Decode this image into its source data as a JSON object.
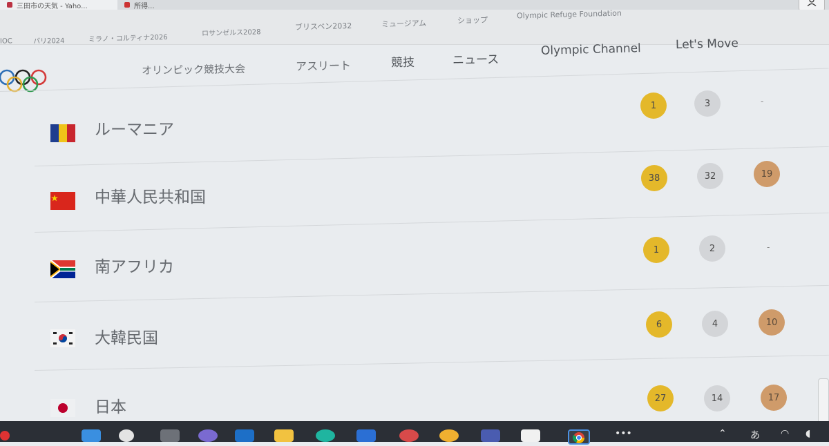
{
  "browser": {
    "tabs": [
      {
        "label": "三田市の天気 - Yaho..."
      },
      {
        "label": "所得..."
      }
    ],
    "profile_icon": "person-icon"
  },
  "meta_nav": {
    "items": [
      "IOC",
      "パリ2024",
      "ミラノ・コルティナ2026",
      "ロサンゼルス2028",
      "ブリスベン2032",
      "ミュージアム",
      "ショップ",
      "Olympic Refuge Foundation"
    ]
  },
  "main_nav": {
    "logo": "olympic-rings",
    "items": [
      "オリンピック競技大会",
      "アスリート",
      "競技",
      "ニュース",
      "Olympic Channel",
      "Let's Move"
    ]
  },
  "medal_table": {
    "rows": [
      {
        "country": "ルーマニア",
        "flag": "romania-flag",
        "gold": "1",
        "silver": "3",
        "bronze": "-"
      },
      {
        "country": "中華人民共和国",
        "flag": "china-flag",
        "gold": "38",
        "silver": "32",
        "bronze": "19"
      },
      {
        "country": "南アフリカ",
        "flag": "south-africa-flag",
        "gold": "1",
        "silver": "2",
        "bronze": "-"
      },
      {
        "country": "大韓民国",
        "flag": "korea-flag",
        "gold": "6",
        "silver": "4",
        "bronze": "10"
      },
      {
        "country": "日本",
        "flag": "japan-flag",
        "gold": "27",
        "silver": "14",
        "bronze": "17"
      }
    ]
  },
  "colors": {
    "gold": "#e4b82a",
    "silver": "#d3d5d8",
    "bronze": "#cf9b6a"
  },
  "taskbar": {
    "icons": [
      "start-icon",
      "search-icon",
      "task-view-icon",
      "chat-icon",
      "outlook-icon",
      "file-explorer-icon",
      "edge-icon",
      "word-icon",
      "app-icon",
      "app-icon-2",
      "app-icon-3",
      "cloud-icon",
      "chrome-icon",
      "more-icon"
    ]
  }
}
